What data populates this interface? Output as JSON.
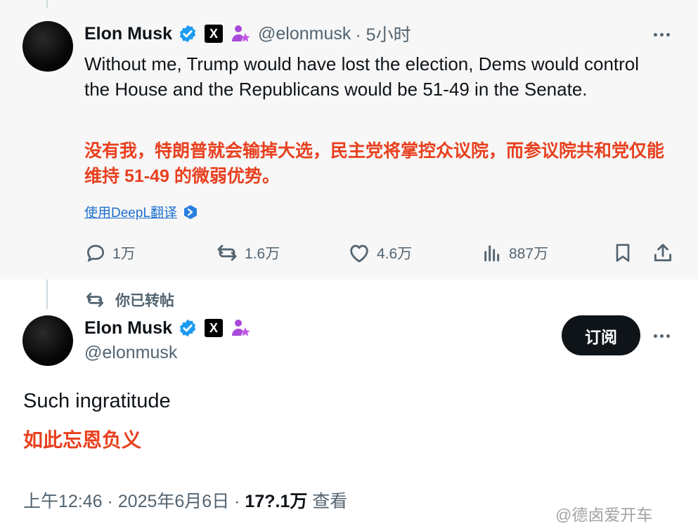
{
  "quoted_tweet": {
    "author_name": "Elon Musk",
    "author_handle": "@elonmusk",
    "time": "· 5小时",
    "text": "Without me, Trump would have lost the election, Dems would control the House and the Republicans would be 51-49 in the Senate.",
    "translation": "没有我，特朗普就会输掉大选，民主党将掌控众议院，而参议院共和党仅能维持 51-49 的微弱优势。",
    "translate_link": "使用DeepL翻译",
    "actions": {
      "replies": "1万",
      "reposts": "1.6万",
      "likes": "4.6万",
      "views": "887万"
    }
  },
  "repost_label": "你已转帖",
  "main_tweet": {
    "author_name": "Elon Musk",
    "author_handle": "@elonmusk",
    "subscribe_label": "订阅",
    "text": "Such ingratitude",
    "translation": "如此忘恩负义",
    "meta_time": "上午12:46 · 2025年6月6日 · ",
    "meta_views": "17?.1万",
    "meta_views_label": " 查看"
  },
  "watermark": "@德卤爱开车",
  "x_glyph": "X",
  "colors": {
    "accent_red": "#e8401f",
    "verified_blue": "#1d9bf0",
    "link_blue": "#1d6fcf",
    "affiliate_purple": "#a74ad9"
  },
  "icons": [
    "verified-badge-icon",
    "x-logo-icon",
    "affiliate-icon",
    "more-icon",
    "reply-icon",
    "repost-icon",
    "like-icon",
    "views-icon",
    "bookmark-icon",
    "share-icon",
    "deepl-icon"
  ]
}
